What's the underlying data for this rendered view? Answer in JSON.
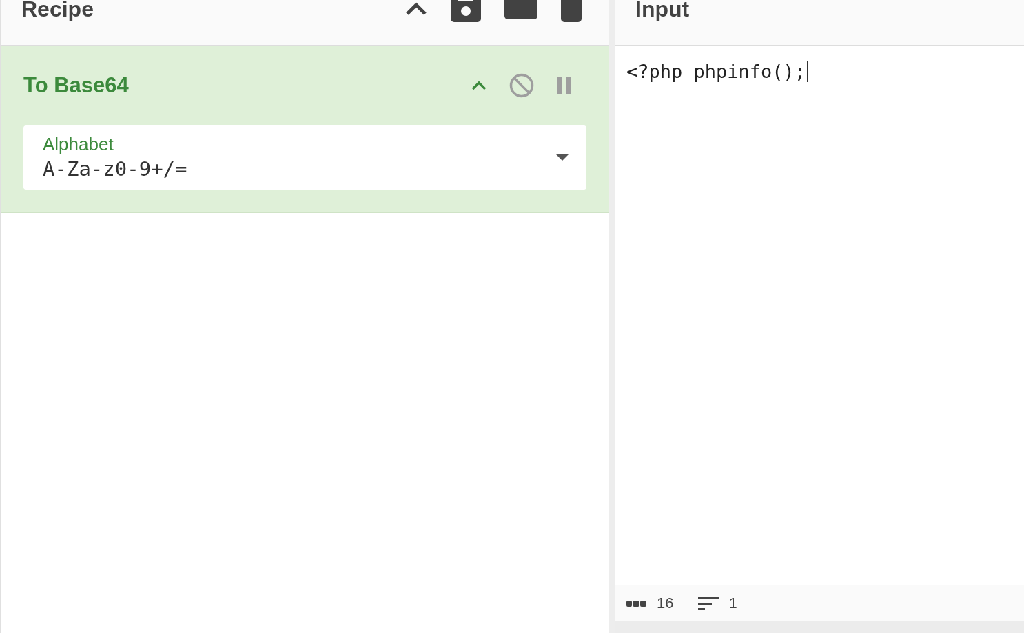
{
  "recipe": {
    "title": "Recipe",
    "operations": [
      {
        "name": "To Base64",
        "args": [
          {
            "label": "Alphabet",
            "value": "A-Za-z0-9+/="
          }
        ]
      }
    ]
  },
  "input": {
    "title": "Input",
    "value": "<?php phpinfo();",
    "status": {
      "length": "16",
      "lines": "1"
    }
  }
}
